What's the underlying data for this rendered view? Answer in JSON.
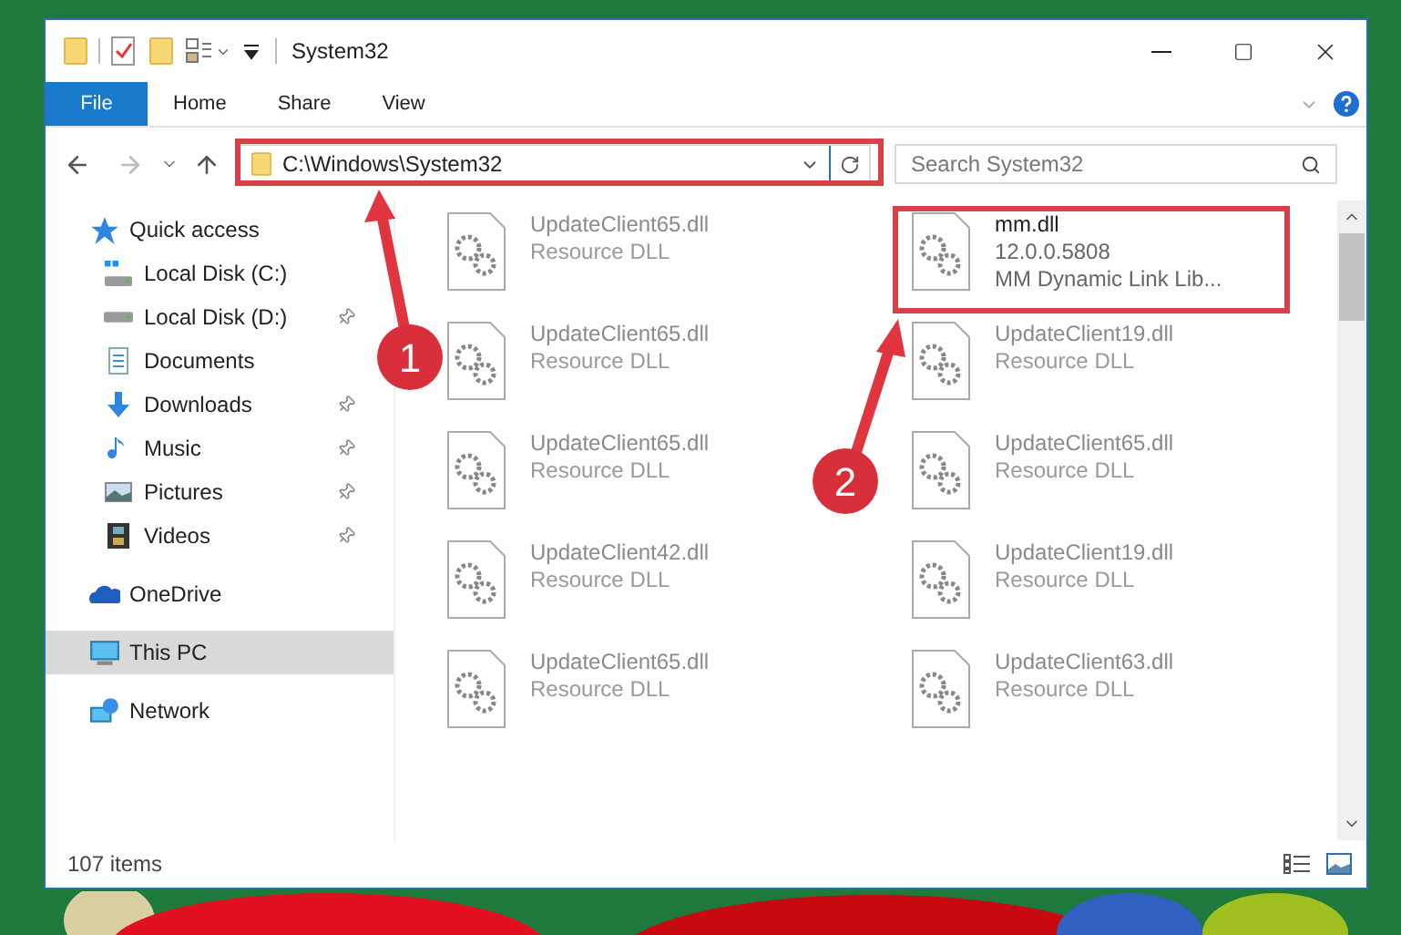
{
  "window": {
    "title": "System32"
  },
  "ribbon_tabs": [
    {
      "label": "File",
      "selected": true
    },
    {
      "label": "Home",
      "selected": false
    },
    {
      "label": "Share",
      "selected": false
    },
    {
      "label": "View",
      "selected": false
    }
  ],
  "address": {
    "path": "C:\\Windows\\System32"
  },
  "search": {
    "placeholder": "Search System32"
  },
  "nav": [
    {
      "label": "Quick access",
      "selected": false,
      "children": [
        {
          "label": "Local Disk (C:)",
          "pinned": false
        },
        {
          "label": "Local Disk (D:)",
          "pinned": true
        },
        {
          "label": "Documents",
          "pinned": false
        },
        {
          "label": "Downloads",
          "pinned": true
        },
        {
          "label": "Music",
          "pinned": true
        },
        {
          "label": "Pictures",
          "pinned": true
        },
        {
          "label": "Videos",
          "pinned": true
        }
      ]
    },
    {
      "label": "OneDrive",
      "selected": false
    },
    {
      "label": "This PC",
      "selected": true
    },
    {
      "label": "Network",
      "selected": false
    }
  ],
  "files": [
    {
      "name": "UpdateClient65.dll",
      "lines": [
        "Resource DLL"
      ],
      "blurred": true
    },
    {
      "name": "mm.dll",
      "lines": [
        "12.0.0.5808",
        "MM Dynamic Link Lib..."
      ],
      "blurred": false
    },
    {
      "name": "UpdateClient65.dll",
      "lines": [
        "Resource DLL"
      ],
      "blurred": true
    },
    {
      "name": "UpdateClient19.dll",
      "lines": [
        "Resource DLL"
      ],
      "blurred": true
    },
    {
      "name": "UpdateClient65.dll",
      "lines": [
        "Resource DLL"
      ],
      "blurred": true
    },
    {
      "name": "UpdateClient65.dll",
      "lines": [
        "Resource DLL"
      ],
      "blurred": true
    },
    {
      "name": "UpdateClient42.dll",
      "lines": [
        "Resource DLL"
      ],
      "blurred": true
    },
    {
      "name": "UpdateClient19.dll",
      "lines": [
        "Resource DLL"
      ],
      "blurred": true
    },
    {
      "name": "UpdateClient65.dll",
      "lines": [
        "Resource DLL"
      ],
      "blurred": true
    },
    {
      "name": "UpdateClient63.dll",
      "lines": [
        "Resource DLL"
      ],
      "blurred": true
    }
  ],
  "status_bar": {
    "count": "107 items"
  },
  "callouts": [
    {
      "number": "1"
    },
    {
      "number": "2"
    }
  ]
}
